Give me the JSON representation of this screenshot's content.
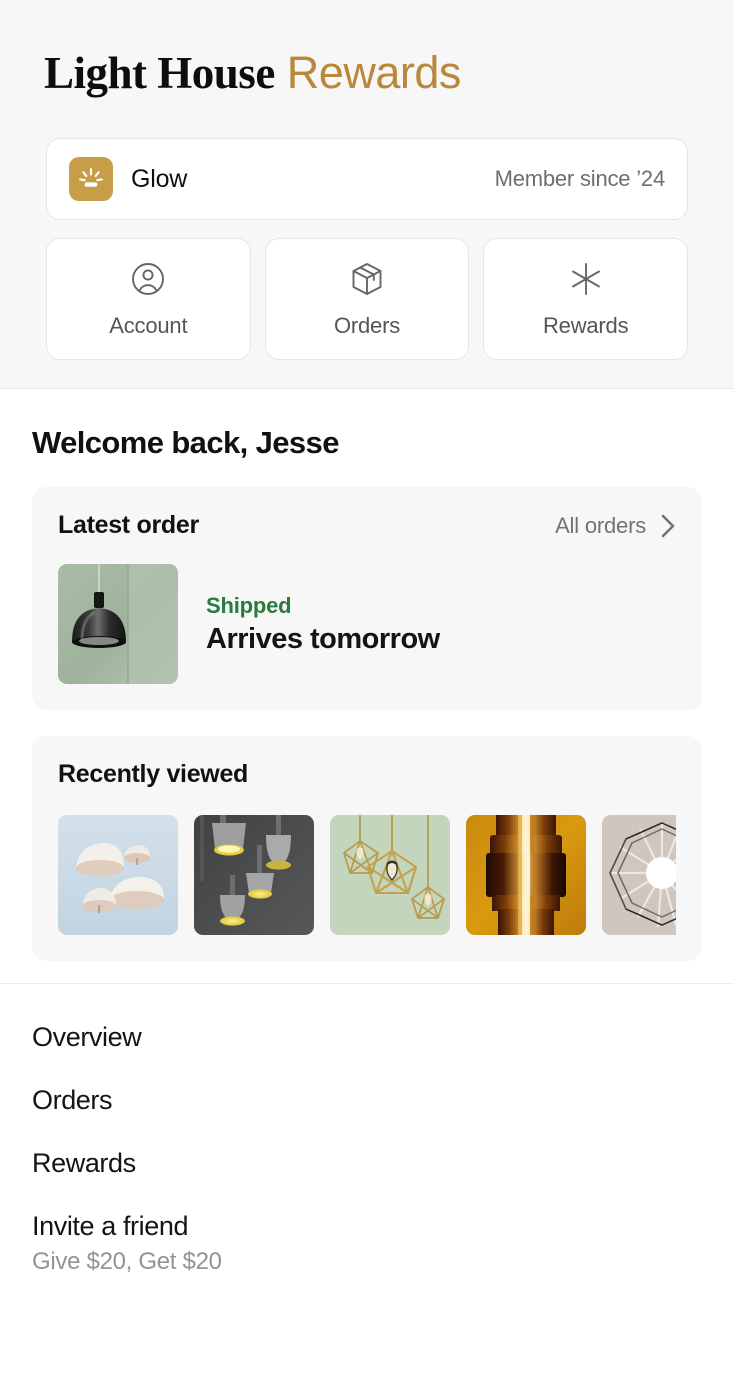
{
  "brand": {
    "name": "Light House",
    "suffix": "Rewards",
    "accent_color": "#b9883a"
  },
  "tier_card": {
    "badge_icon": "glow-sunburst-icon",
    "badge_color": "#c89d48",
    "tier_label": "Glow",
    "member_since": "Member since ’24"
  },
  "quick_tiles": [
    {
      "label": "Account",
      "icon": "user-circle-icon"
    },
    {
      "label": "Orders",
      "icon": "package-box-icon"
    },
    {
      "label": "Rewards",
      "icon": "asterisk-star-icon"
    }
  ],
  "main": {
    "welcome": "Welcome back, Jesse",
    "latest_order": {
      "title": "Latest order",
      "link_label": "All orders",
      "link_icon": "chevron-right-icon",
      "status": "Shipped",
      "status_color": "#2b7a3e",
      "eta": "Arrives tomorrow",
      "thumbnail_alt": "dark-dome-pendant-lamp"
    },
    "recently_viewed": {
      "title": "Recently viewed",
      "items": [
        {
          "alt": "white-dome-cluster-pendants",
          "bg": "#ccdbe6"
        },
        {
          "alt": "gray-pendants-yellow-glow",
          "bg": "#4d4f50"
        },
        {
          "alt": "gold-geometric-cage-pendants",
          "bg": "#c3d6bd"
        },
        {
          "alt": "amber-copper-tiered-pendant",
          "bg": "#d08a14"
        },
        {
          "alt": "white-starburst-pleated-pendant",
          "bg": "#cfc6bf"
        }
      ]
    }
  },
  "nav": {
    "items": [
      {
        "label": "Overview",
        "sub": ""
      },
      {
        "label": "Orders",
        "sub": ""
      },
      {
        "label": "Rewards",
        "sub": ""
      },
      {
        "label": "Invite a friend",
        "sub": "Give $20, Get $20"
      }
    ]
  }
}
